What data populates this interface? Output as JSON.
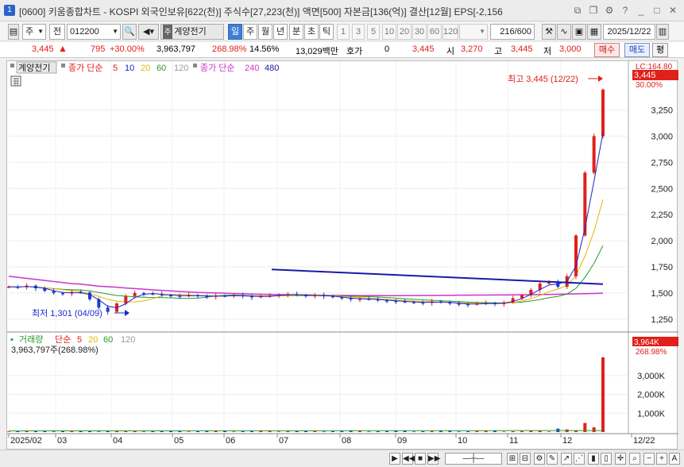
{
  "window": {
    "number": "1",
    "title": "[0600] 키움종합차트 - KOSPI 외국인보유[622(천)] 주식수[27,223(천)] 액면[500] 자본금[136(억)] 결산[12월] EPS[-2,156"
  },
  "toolbar": {
    "stock_type": "주",
    "prefix": "전",
    "code": "012200",
    "stock_name": "계양전기",
    "periods": [
      "일",
      "주",
      "월",
      "년",
      "분",
      "초",
      "틱"
    ],
    "active_period": "일",
    "intervals": [
      "1",
      "3",
      "5",
      "10",
      "20",
      "30",
      "60",
      "120"
    ],
    "count": "216",
    "count_max": "/600",
    "date": "2025/12/22"
  },
  "pricebar": {
    "price": "3,445",
    "change": "795",
    "change_pct": "+30.00%",
    "volume": "3,963,797",
    "volume_ratio": "268.98%",
    "turnover": "14.56%",
    "amount": "13,029백만",
    "quote_label": "호가",
    "quote_val": "0",
    "bid": "3,445",
    "open_label": "시",
    "open_val": "3,270",
    "high_label": "고",
    "high_val": "3,445",
    "low_label": "저",
    "low_val": "3,000",
    "buy": "매수",
    "sell": "매도",
    "eval": "평"
  },
  "legend": {
    "stock": "계양전기",
    "ma_label": "종가 단순",
    "ma_periods": [
      "5",
      "10",
      "20",
      "60",
      "120"
    ],
    "ma_colors": [
      "#e0201a",
      "#2222cc",
      "#e8b400",
      "#2a9a2a",
      "#999999"
    ],
    "ma2_label": "종가 단순",
    "ma2_periods": [
      "240",
      "480"
    ],
    "ma2_colors": [
      "#cc33cc",
      "#1a1aa8"
    ]
  },
  "annotations": {
    "high": "최고 3,445 (12/22)",
    "low": "최저 1,301 (04/09)",
    "last_price": "3,445",
    "last_pct": "30.00%",
    "limit": "LC:164.80"
  },
  "price_axis": [
    "3,250",
    "3,000",
    "2,750",
    "2,500",
    "2,250",
    "2,000",
    "1,750",
    "1,500",
    "1,250"
  ],
  "volume_pane": {
    "label": "거래량",
    "ma_label": "단순",
    "ma_periods": [
      "5",
      "20",
      "60",
      "120"
    ],
    "ma_colors": [
      "#e0201a",
      "#e8b400",
      "#2a9a2a",
      "#999999"
    ],
    "current": "3,963,797주(268.98%)",
    "last": "3,964K",
    "last_pct": "268.98%",
    "axis": [
      "3,000K",
      "2,000K",
      "1,000K"
    ]
  },
  "date_axis": [
    "2025/02",
    "03",
    "04",
    "05",
    "06",
    "07",
    "08",
    "09",
    "10",
    "11",
    "12",
    "12/22"
  ],
  "chart_data": {
    "type": "candlestick",
    "ylim": [
      1150,
      3550
    ],
    "volume_ylim": [
      0,
      4000
    ],
    "months": [
      "2025/02",
      "03",
      "04",
      "05",
      "06",
      "07",
      "08",
      "09",
      "10",
      "11",
      "12"
    ],
    "close_series": [
      1560,
      1555,
      1570,
      1545,
      1520,
      1500,
      1495,
      1510,
      1505,
      1440,
      1360,
      1320,
      1400,
      1470,
      1500,
      1495,
      1490,
      1480,
      1475,
      1470,
      1480,
      1470,
      1465,
      1475,
      1470,
      1480,
      1470,
      1460,
      1470,
      1475,
      1485,
      1490,
      1480,
      1470,
      1480,
      1470,
      1460,
      1450,
      1440,
      1445,
      1440,
      1430,
      1425,
      1420,
      1415,
      1410,
      1405,
      1420,
      1410,
      1400,
      1395,
      1390,
      1400,
      1405,
      1395,
      1410,
      1450,
      1480,
      1530,
      1590,
      1610,
      1560,
      1660,
      2050,
      2650,
      3000,
      3445
    ],
    "ma240": [
      1660,
      1650,
      1640,
      1630,
      1620,
      1610,
      1600,
      1590,
      1585,
      1575,
      1565,
      1560,
      1555,
      1548,
      1542,
      1536,
      1530,
      1525,
      1520,
      1515,
      1510,
      1505,
      1502,
      1500,
      1498,
      1495,
      1493,
      1490,
      1488,
      1486,
      1484,
      1483,
      1482,
      1481,
      1480,
      1479,
      1478,
      1477,
      1477,
      1476,
      1476,
      1475,
      1475,
      1475,
      1476,
      1476,
      1477,
      1477,
      1478,
      1478,
      1479,
      1479,
      1480,
      1480,
      1481,
      1481,
      1482,
      1482,
      1483,
      1485,
      1486,
      1488,
      1490,
      1492,
      1494,
      1496,
      1498
    ],
    "trend_line": {
      "start": 1725,
      "end": 1585
    },
    "volume_spikes_k": [
      180,
      140,
      60,
      480,
      250,
      3964
    ],
    "high": 3445,
    "low": 1301
  }
}
